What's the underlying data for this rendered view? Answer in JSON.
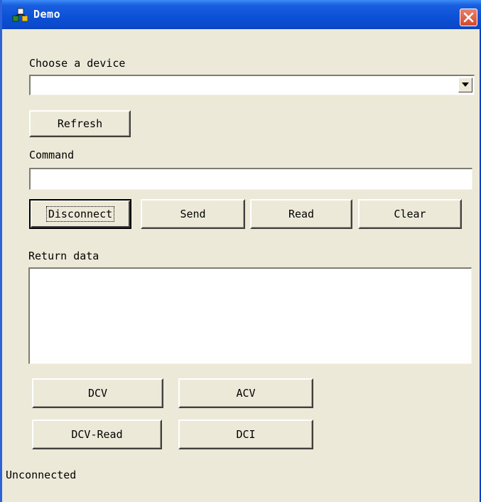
{
  "window": {
    "title": "Demo",
    "icon": "app-icon"
  },
  "device": {
    "label": "Choose a device",
    "selected": ""
  },
  "refresh_label": "Refresh",
  "command": {
    "label": "Command",
    "value": ""
  },
  "actions": {
    "disconnect": "Disconnect",
    "send": "Send",
    "read": "Read",
    "clear": "Clear"
  },
  "return_data": {
    "label": "Return data",
    "value": ""
  },
  "measure": {
    "dcv": "DCV",
    "acv": "ACV",
    "dcv_read": "DCV-Read",
    "dci": "DCI"
  },
  "status": "Unconnected"
}
